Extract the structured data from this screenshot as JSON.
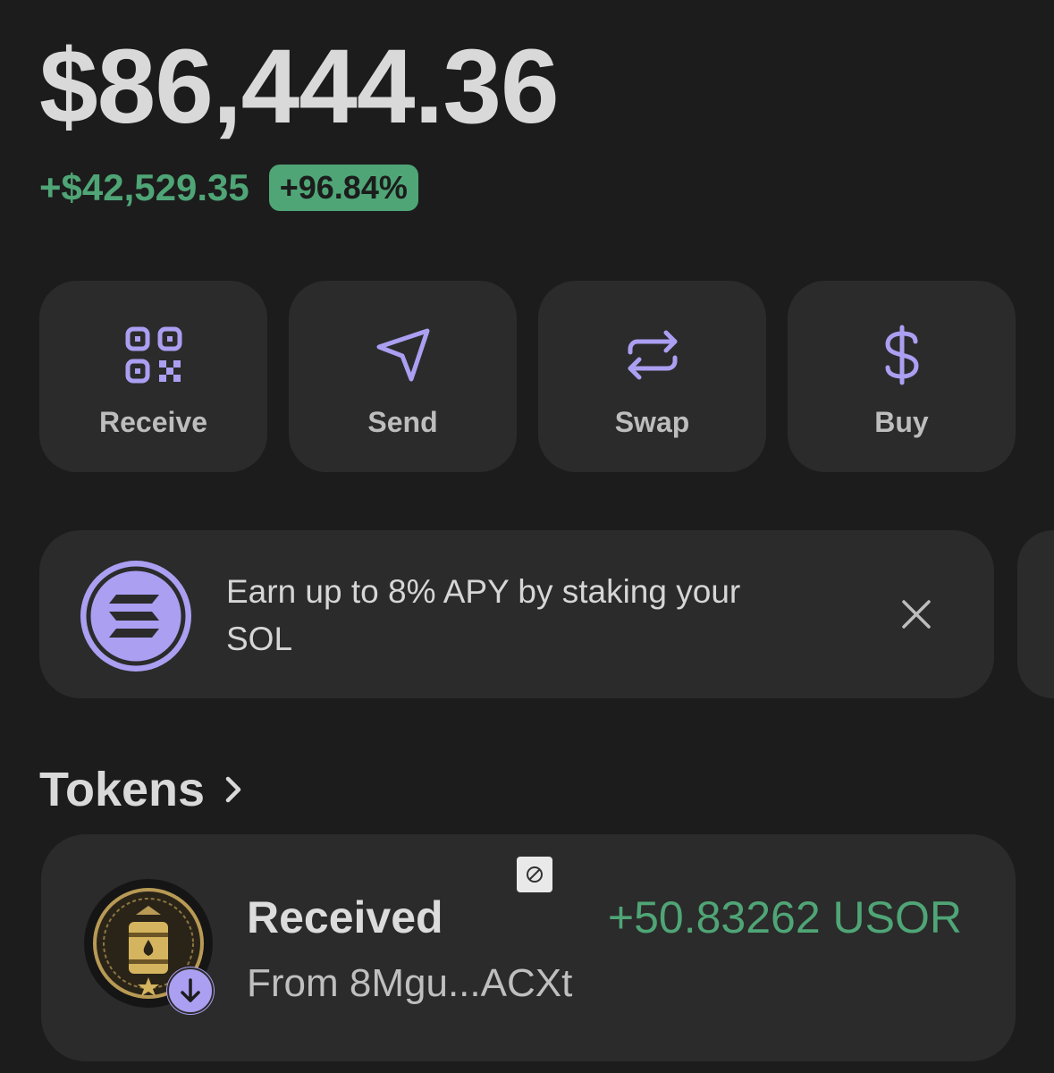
{
  "wallet": {
    "balance": "$86,444.36",
    "change_amount": "+$42,529.35",
    "change_percent": "+96.84%"
  },
  "colors": {
    "background": "#1c1c1c",
    "card": "#2b2b2b",
    "accent_purple": "#ab9ff2",
    "positive_green": "#4fa576"
  },
  "actions": [
    {
      "label": "Receive",
      "icon": "qr-code-icon"
    },
    {
      "label": "Send",
      "icon": "send-icon"
    },
    {
      "label": "Swap",
      "icon": "swap-icon"
    },
    {
      "label": "Buy",
      "icon": "dollar-icon"
    }
  ],
  "banner": {
    "text": "Earn up to 8% APY by staking your SOL",
    "icon": "solana-logo-icon",
    "close_icon": "close-icon"
  },
  "tokens_section": {
    "title": "Tokens"
  },
  "activity": {
    "title": "Received",
    "subtitle": "From 8Mgu...ACXt",
    "amount": "+50.83262 USOR",
    "token_icon": "usor-token-icon",
    "badge_icon": "arrow-down-icon",
    "hidden_icon": "hidden-icon"
  }
}
